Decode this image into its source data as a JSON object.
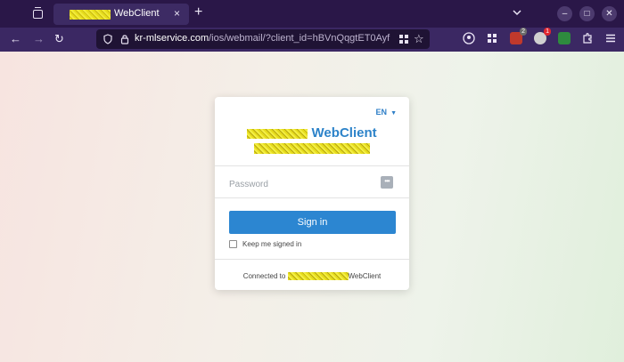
{
  "browser": {
    "tab_title": "WebClient",
    "tab_close": "×",
    "new_tab": "+",
    "url_host": "kr-mlservice.com",
    "url_path": "/ios/webmail/?client_id=hBVnQqgtET0Ayf",
    "extension_badges": [
      "2",
      "1"
    ]
  },
  "login": {
    "language": "EN",
    "language_arrow": "▼",
    "brand_suffix": "WebClient",
    "password_placeholder": "Password",
    "sign_in_label": "Sign in",
    "keep_signed_in_label": "Keep me signed in",
    "connected_prefix": "Connected to ",
    "connected_suffix": "WebClient"
  },
  "colors": {
    "accent": "#2c86d1",
    "tabbar": "#2a1748",
    "navbar": "#3b2863"
  },
  "icons": [
    "tab-list-icon",
    "close-icon",
    "plus-icon",
    "chevron-down-icon",
    "minimize-icon",
    "maximize-icon",
    "close-window-icon",
    "back-icon",
    "forward-icon",
    "reload-icon",
    "shield-icon",
    "lock-icon",
    "grid-icon",
    "star-icon",
    "account-icon",
    "extensions-grid-icon",
    "puzzle-icon",
    "menu-icon",
    "key-icon"
  ]
}
